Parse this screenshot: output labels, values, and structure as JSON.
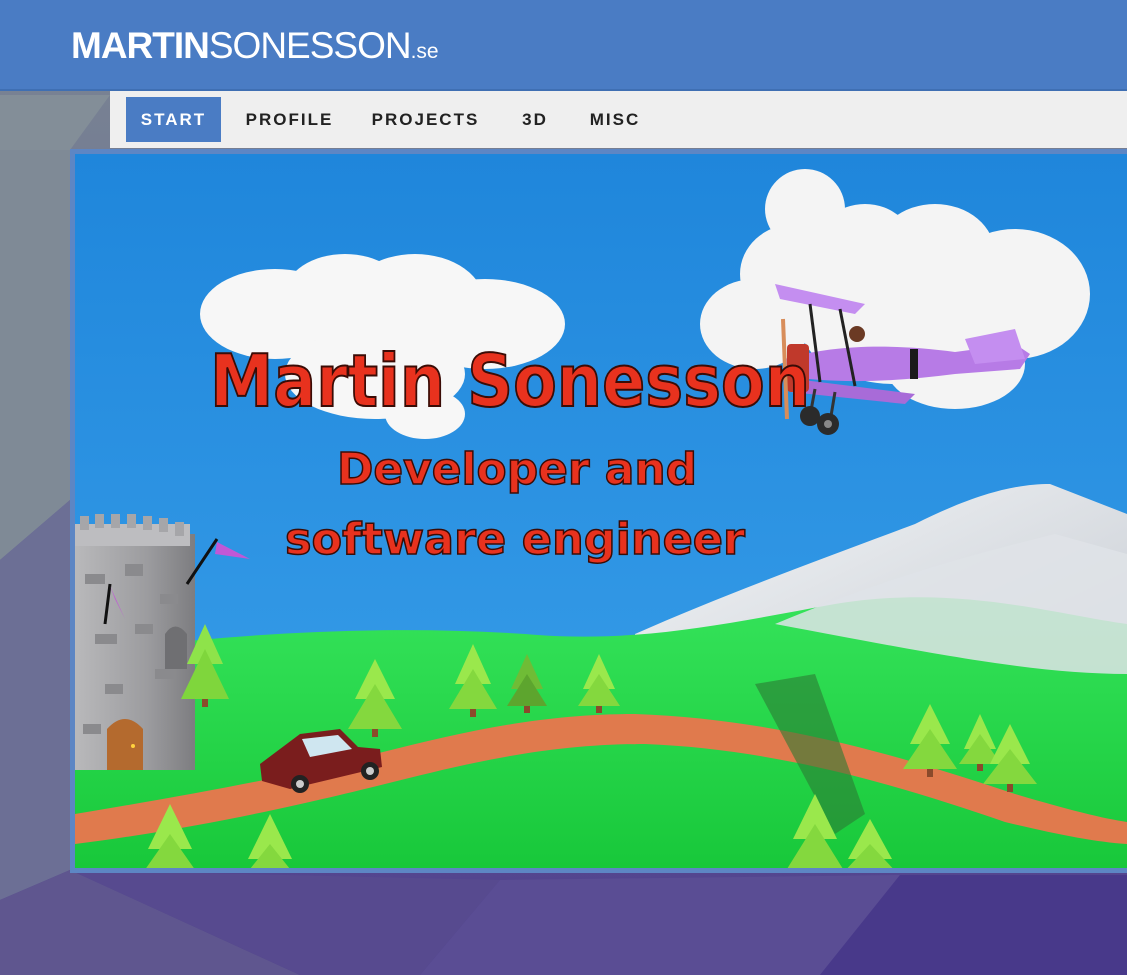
{
  "site": {
    "logo_bold": "MARTIN",
    "logo_light": "SONESSON",
    "logo_tld": ".se"
  },
  "nav": {
    "items": [
      {
        "label": "START",
        "active": true
      },
      {
        "label": "PROFILE",
        "active": false
      },
      {
        "label": "PROJECTS",
        "active": false
      },
      {
        "label": "3D",
        "active": false
      },
      {
        "label": "MISC",
        "active": false
      }
    ]
  },
  "hero": {
    "title": "Martin Sonesson",
    "subtitle_line1": "Developer and",
    "subtitle_line2": "software engineer"
  },
  "colors": {
    "header": "#4a7cc4",
    "nav_active": "#4a7cc4",
    "sky": "#2a8fe0",
    "grass": "#2ee24a",
    "title_red": "#e8321e",
    "plane_purple": "#b77be6"
  }
}
